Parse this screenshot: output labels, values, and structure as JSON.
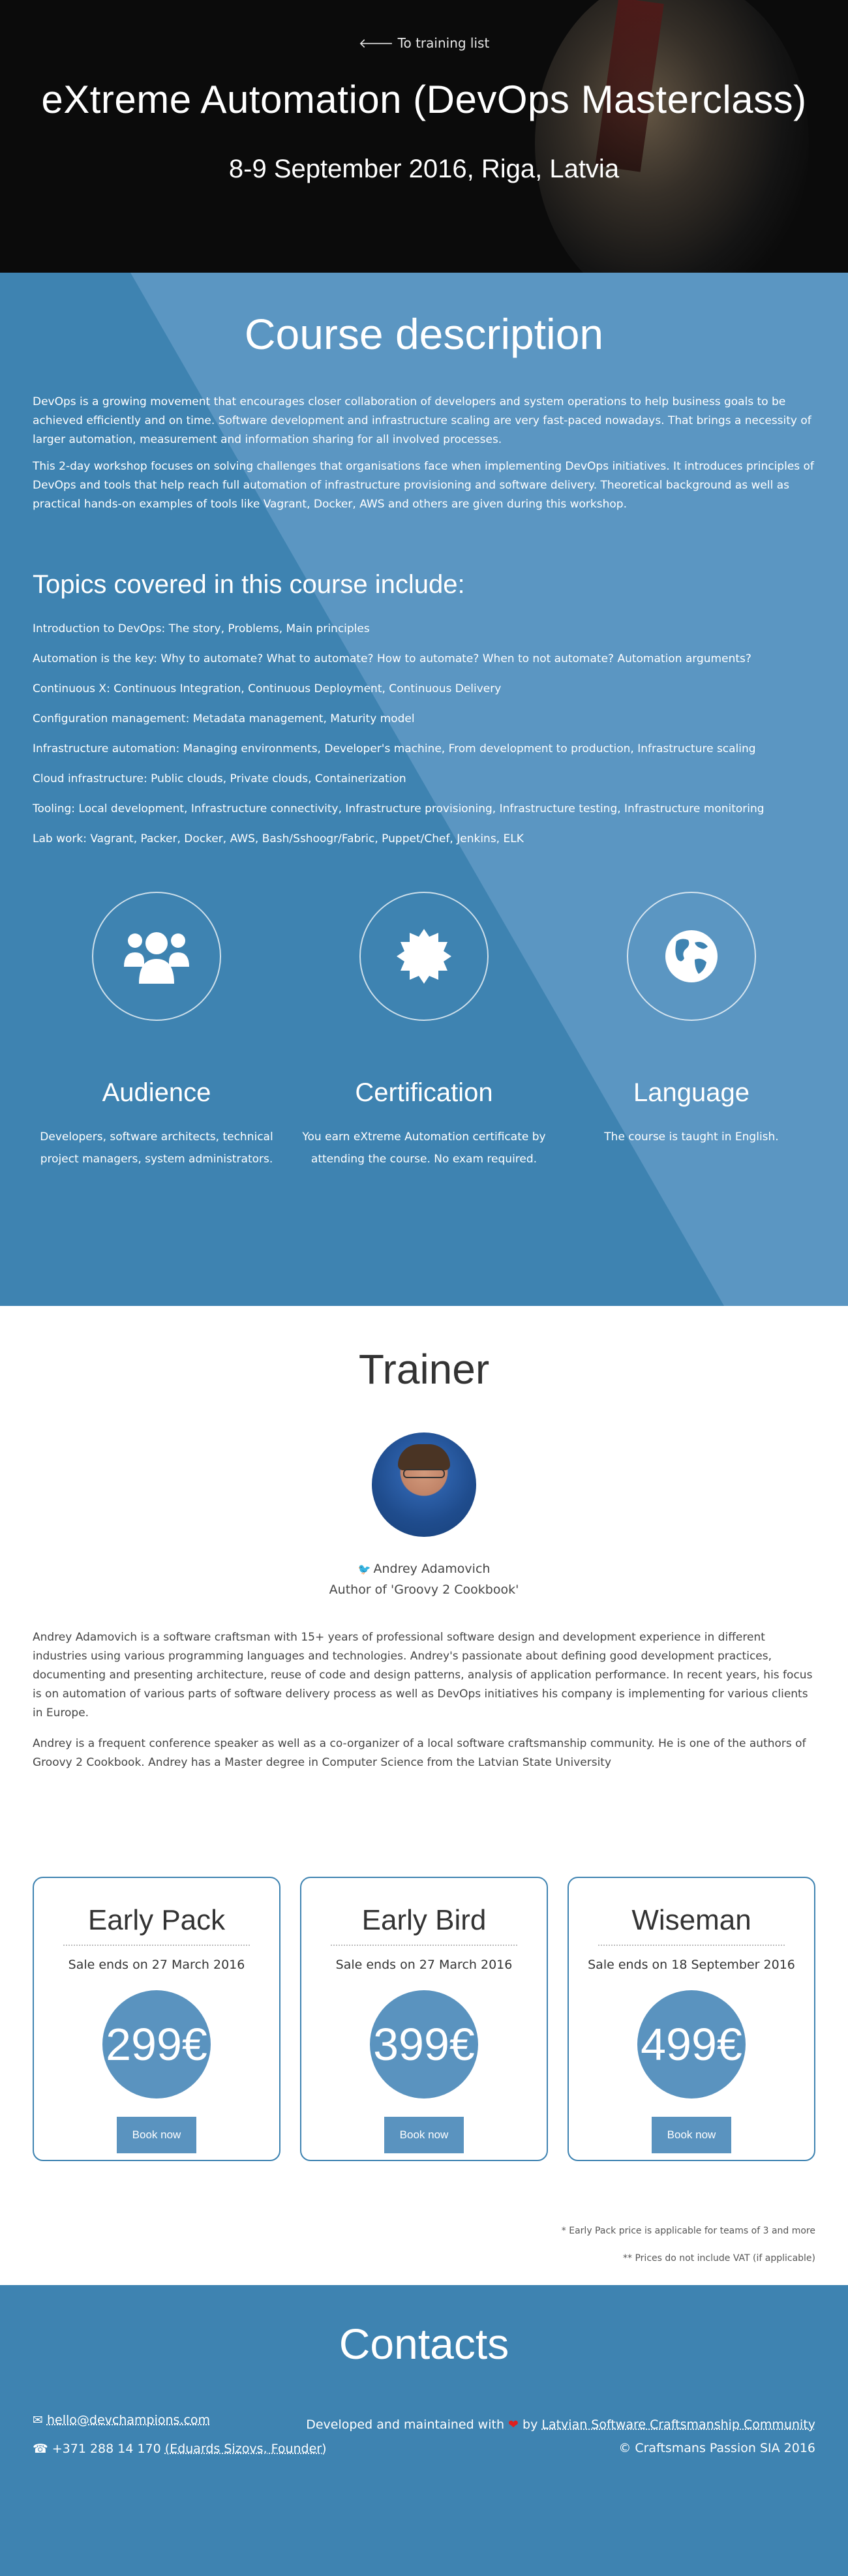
{
  "hero": {
    "back_link": "🡐 To training list",
    "title": "eXtreme Automation (DevOps Masterclass)",
    "date": "8-9 September 2016, Riga, Latvia"
  },
  "description": {
    "heading": "Course description",
    "paragraph1": "DevOps is a growing movement that encourages closer collaboration of developers and system operations to help business goals to be achieved efficiently and on time. Software development and infrastructure scaling are very fast-paced nowadays. That brings a necessity of larger automation, measurement and information sharing for all involved processes.",
    "paragraph2": "This 2-day workshop focuses on solving challenges that organisations face when implementing DevOps initiatives. It introduces principles of DevOps and tools that help reach full automation of infrastructure provisioning and software delivery. Theoretical background as well as practical hands-on examples of tools like Vagrant, Docker, AWS and others are given during this workshop.",
    "topics_heading": "Topics covered in this course include:",
    "topics": [
      "Introduction to DevOps: The story, Problems, Main principles",
      "Automation is the key: Why to automate? What to automate? How to automate? When to not automate? Automation arguments?",
      "Continuous X: Continuous Integration, Continuous Deployment, Continuous Delivery",
      "Configuration management: Metadata management, Maturity model",
      "Infrastructure automation: Managing environments, Developer's machine, From development to production, Infrastructure scaling",
      "Cloud infrastructure: Public clouds, Private clouds, Containerization",
      "Tooling: Local development, Infrastructure connectivity, Infrastructure provisioning, Infrastructure testing, Infrastructure monitoring",
      "Lab work: Vagrant, Packer, Docker, AWS, Bash/Sshoogr/Fabric, Puppet/Chef, Jenkins, ELK"
    ],
    "features": [
      {
        "icon": "users-icon",
        "title": "Audience",
        "text": "Developers, software architects, technical project managers, system administrators."
      },
      {
        "icon": "certificate-icon",
        "title": "Certification",
        "text": "You earn eXtreme Automation certificate by attending the course. No exam required."
      },
      {
        "icon": "globe-icon",
        "title": "Language",
        "text": "The course is taught in English."
      }
    ]
  },
  "trainer": {
    "heading": "Trainer",
    "name": "Andrey Adamovich",
    "role": "Author of 'Groovy 2 Cookbook'",
    "bio1": "Andrey Adamovich is a software craftsman with 15+ years of professional software design and development experience in different industries using various programming languages and technologies. Andrey's passionate about defining good development practices, documenting and presenting architecture, reuse of code and design patterns, analysis of application performance. In recent years, his focus is on automation of various parts of software delivery process as well as DevOps initiatives his company is implementing for various clients in Europe.",
    "bio2": "Andrey is a frequent conference speaker as well as a co-organizer of a local software craftsmanship community. He is one of the authors of Groovy 2 Cookbook. Andrey has a Master degree in Computer Science from the Latvian State University"
  },
  "pricing": {
    "plans": [
      {
        "name": "Early Pack",
        "ends": "Sale ends on 27 March 2016",
        "price": "299€",
        "button": "Book now"
      },
      {
        "name": "Early Bird",
        "ends": "Sale ends on 27 March 2016",
        "price": "399€",
        "button": "Book now"
      },
      {
        "name": "Wiseman",
        "ends": "Sale ends on 18 September 2016",
        "price": "499€",
        "button": "Book now"
      }
    ],
    "note1": "* Early Pack price is applicable for teams of 3 and more",
    "note2": "** Prices do not include VAT (if applicable)"
  },
  "contacts": {
    "heading": "Contacts",
    "email": "hello@devchampions.com",
    "phone_prefix": "+371 288 14 170",
    "phone_person": "(Eduards Sizovs, Founder)",
    "dev_prefix": "Developed and maintained with",
    "dev_by": "by",
    "community": "Latvian Software Craftsmanship Community",
    "copyright": "© Craftsmans Passion SIA 2016"
  },
  "colors": {
    "primary": "#3e83b1",
    "light_band": "#5a93bf",
    "dark_hero": "#0b0b0b",
    "heart": "#e0201e"
  }
}
